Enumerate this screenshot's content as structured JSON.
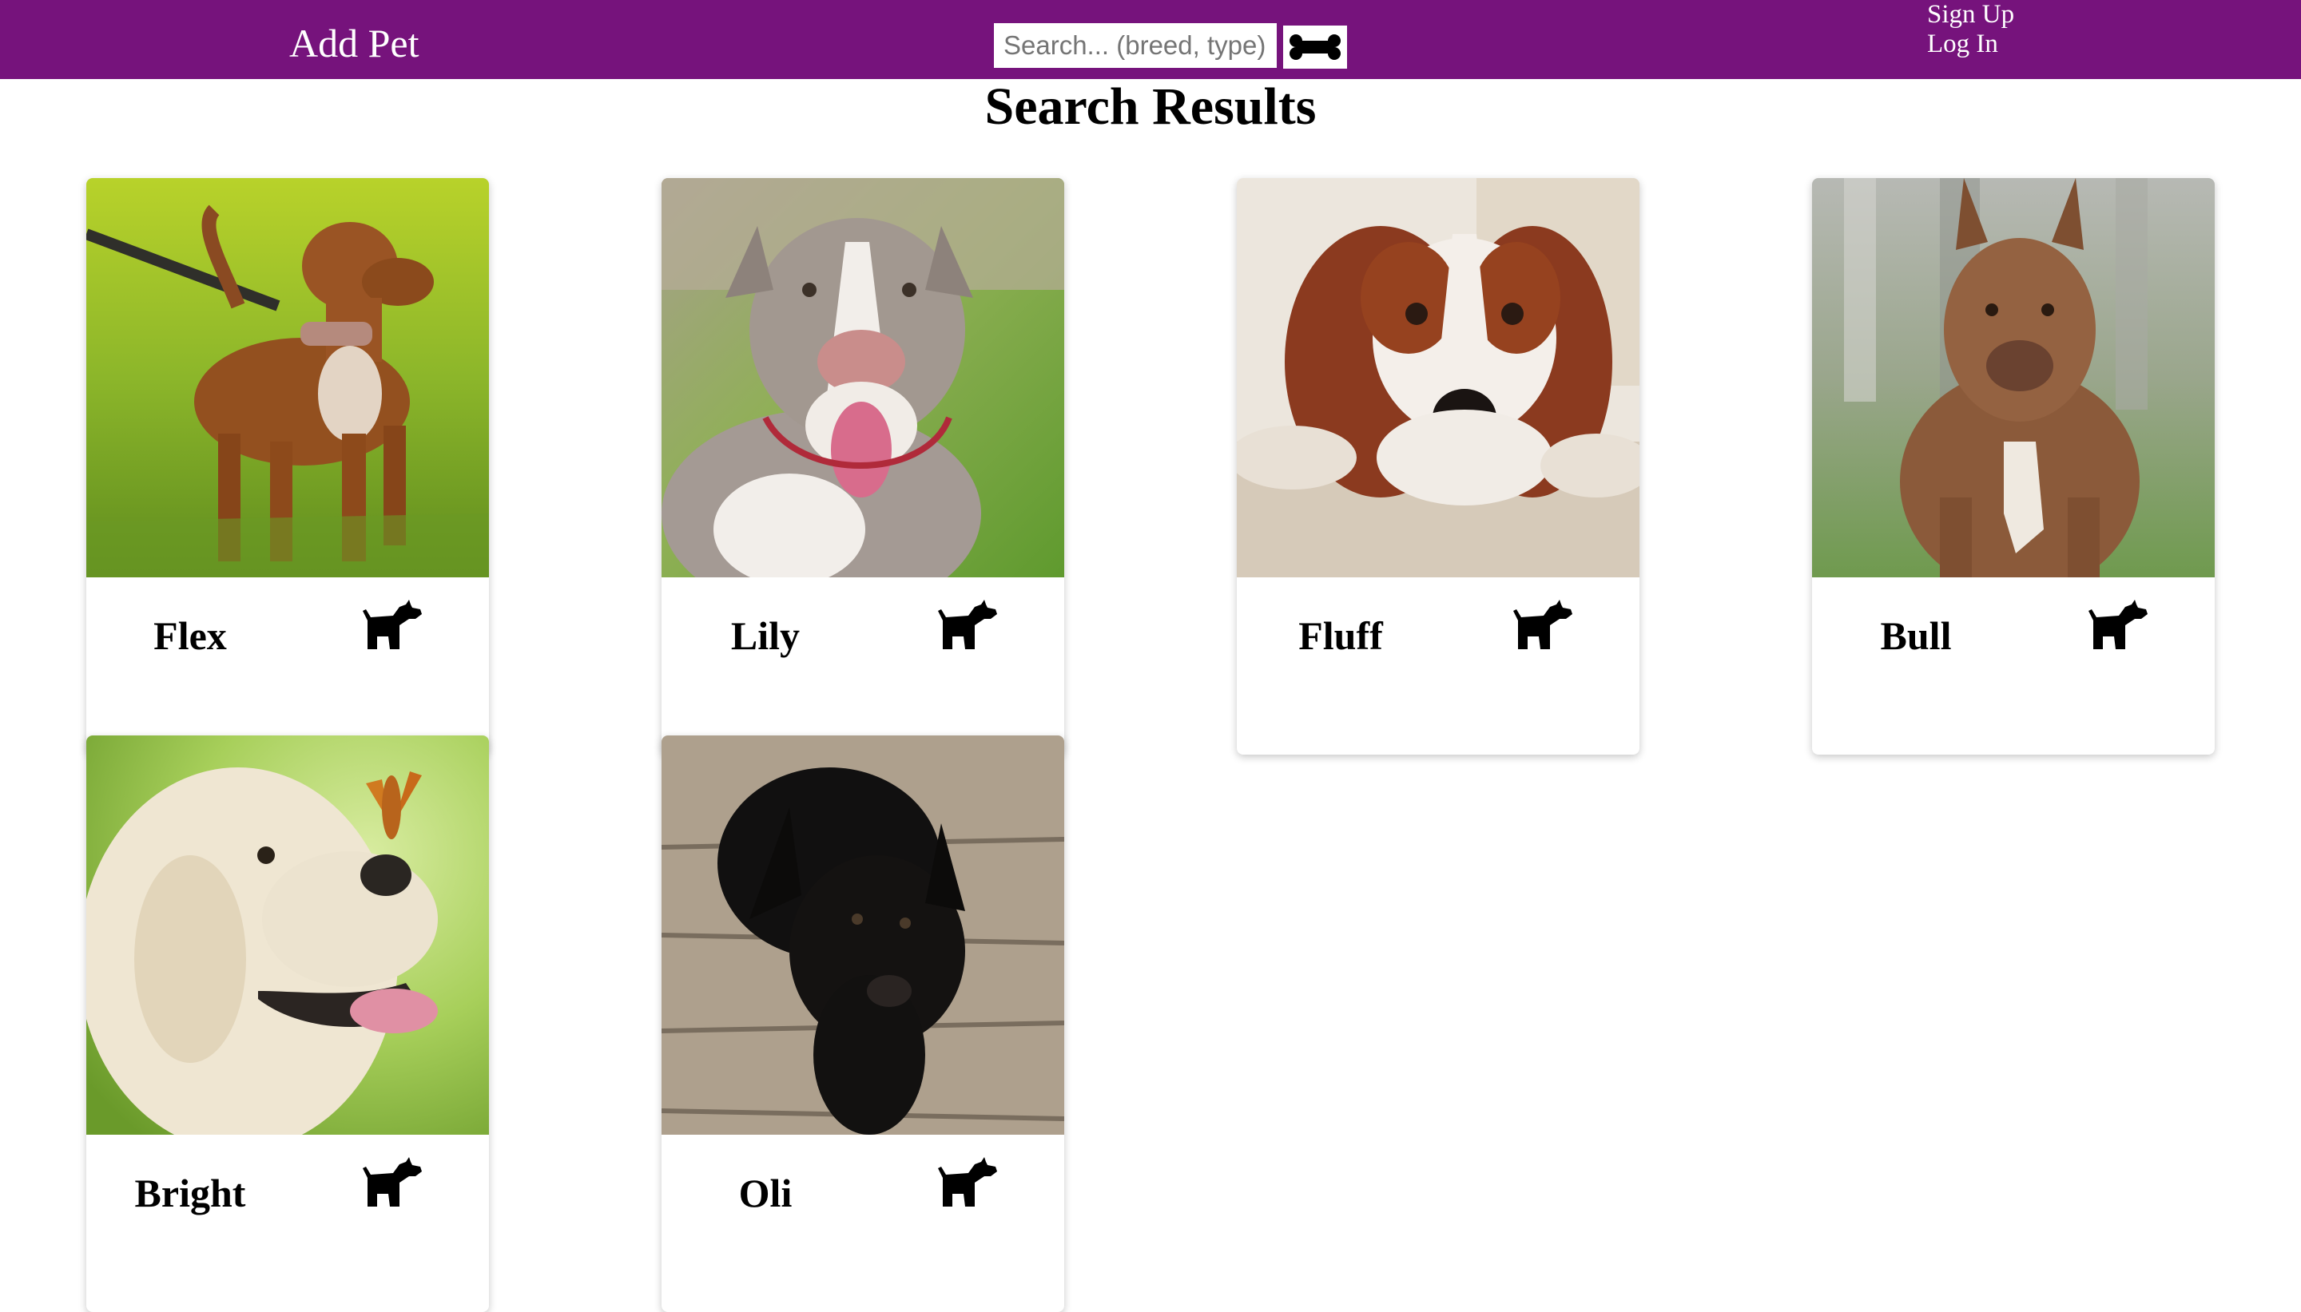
{
  "navbar": {
    "add_pet_label": "Add Pet",
    "search_placeholder": "Search... (breed, type)",
    "search_button_icon": "bone-icon",
    "sign_up_label": "Sign Up",
    "log_in_label": "Log In",
    "background_color": "#76137c"
  },
  "main": {
    "title": "Search Results",
    "pets": [
      {
        "name": "Flex",
        "icon": "dog-icon",
        "photo": "brown pit bull on grass on a leash"
      },
      {
        "name": "Lily",
        "icon": "dog-icon",
        "photo": "grey and white pit bull smiling"
      },
      {
        "name": "Fluff",
        "icon": "dog-icon",
        "photo": "cavalier spaniel lying on carpet"
      },
      {
        "name": "Bull",
        "icon": "dog-icon",
        "photo": "brown bully dog standing"
      },
      {
        "name": "Bright",
        "icon": "dog-icon",
        "photo": "golden retriever puppy with butterfly on nose"
      },
      {
        "name": "Oli",
        "icon": "dog-icon",
        "photo": "black labrador on wooden floor"
      }
    ]
  }
}
